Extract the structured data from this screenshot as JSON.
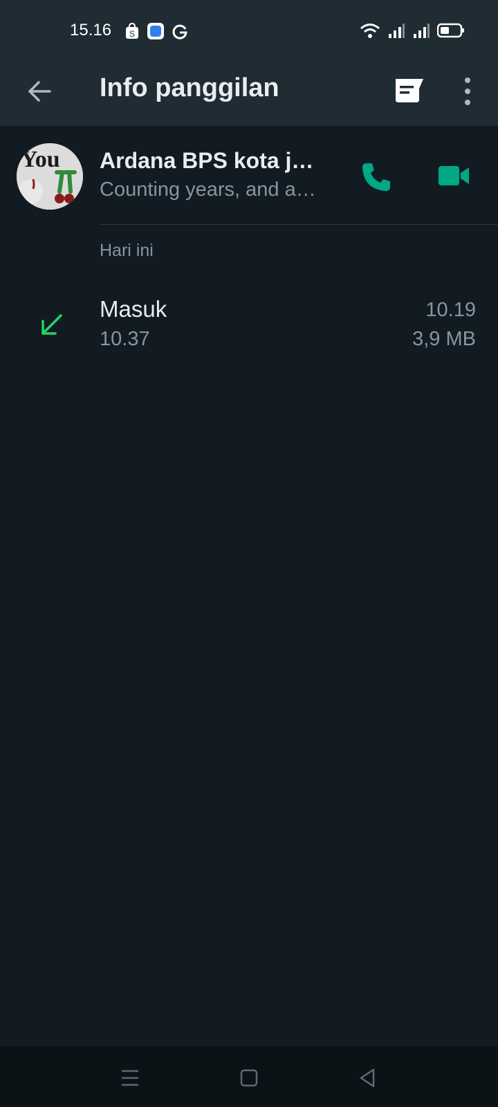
{
  "status_bar": {
    "time": "15.16",
    "left_icons": [
      "shopee-icon",
      "app-icon",
      "google-icon"
    ],
    "right_icons": [
      "wifi-icon",
      "signal-icon",
      "signal-icon",
      "battery-icon"
    ]
  },
  "appbar": {
    "title": "Info panggilan",
    "back_icon": "arrow-left-icon",
    "message_icon": "message-icon",
    "more_icon": "more-vertical-icon"
  },
  "contact": {
    "name": "Ardana BPS kota j…",
    "status": "Counting years, and a…",
    "call_icon": "phone-icon",
    "video_icon": "video-icon"
  },
  "section": {
    "header": "Hari ini"
  },
  "calls": [
    {
      "direction_icon": "incoming-arrow-icon",
      "type": "Masuk",
      "time": "10.37",
      "right_time": "10.19",
      "size": "3,9 MB"
    }
  ],
  "colors": {
    "background": "#121b22",
    "appbar": "#1f2c34",
    "accent": "#00a884",
    "incoming": "#25d366",
    "secondary_text": "#8696a0"
  },
  "nav": {
    "icons": [
      "menu-icon",
      "home-icon",
      "back-triangle-icon"
    ]
  }
}
